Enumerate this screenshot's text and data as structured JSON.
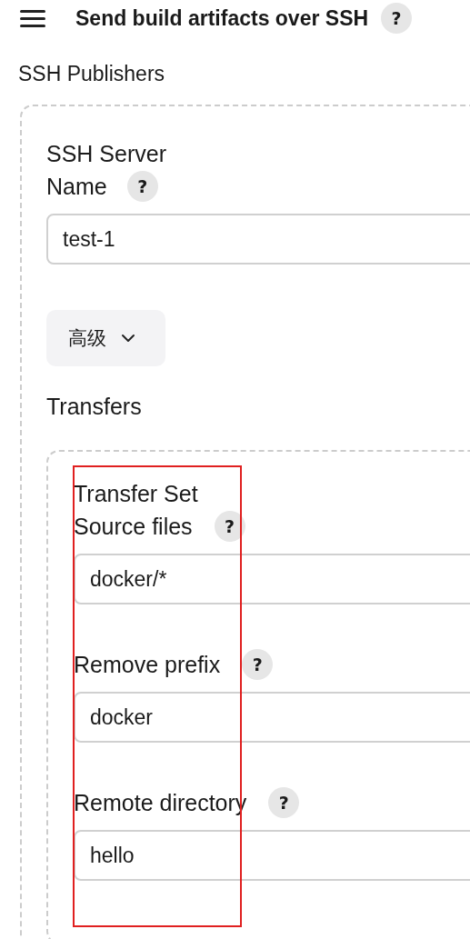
{
  "header": {
    "title": "Send build artifacts over SSH",
    "help": "?"
  },
  "section_title": "SSH Publishers",
  "publisher": {
    "name_label_lines": [
      "SSH Server",
      "Name"
    ],
    "name_help": "?",
    "name_value": "test-1",
    "advanced_button": "高级",
    "transfers_title": "Transfers",
    "transfer_set": {
      "title": "Transfer Set",
      "fields": [
        {
          "label": "Source files",
          "help": "?",
          "value": "docker/*"
        },
        {
          "label": "Remove prefix",
          "help": "?",
          "value": "docker"
        },
        {
          "label": "Remote directory",
          "help": "?",
          "value": "hello"
        }
      ]
    }
  },
  "annotation": {
    "kind": "highlight-rectangle",
    "color": "#e02020"
  }
}
